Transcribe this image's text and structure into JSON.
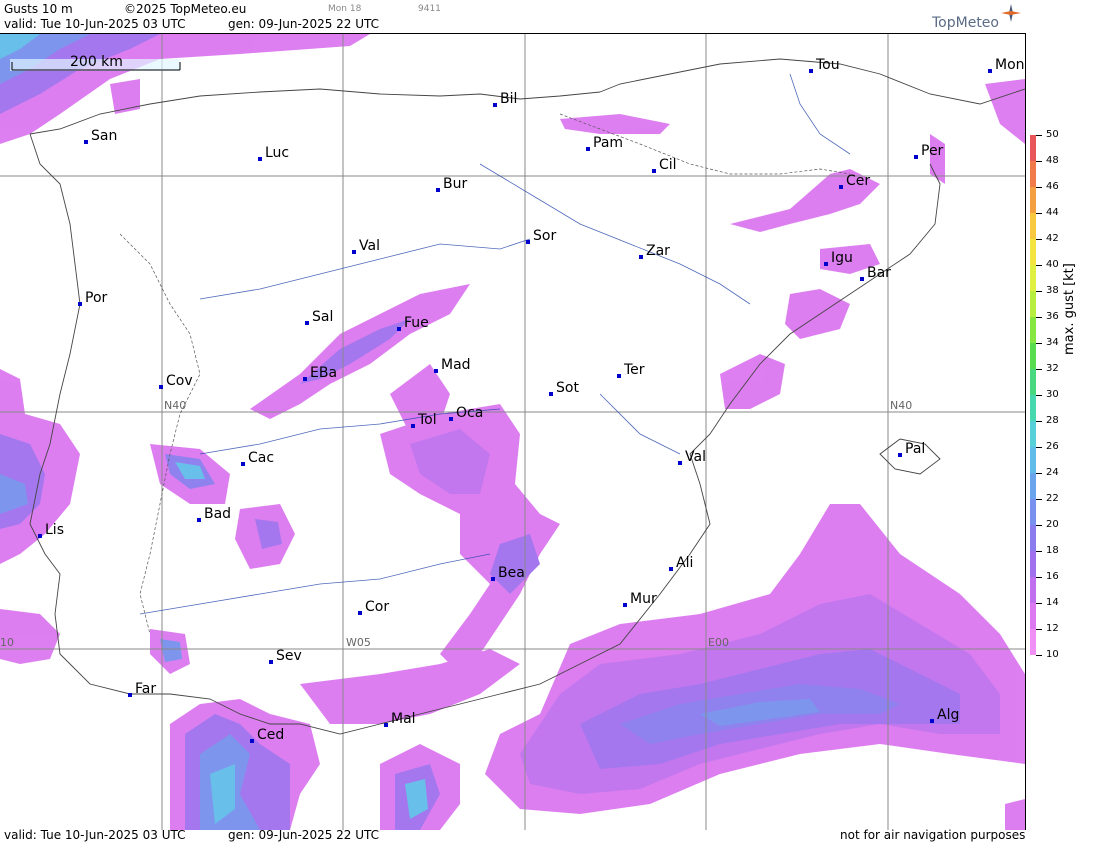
{
  "header": {
    "field": "Gusts 10 m",
    "copyright": "©2025 TopMeteo.eu",
    "run_day": "Mon 18",
    "run_code": "9411",
    "valid": "valid:  Tue  10-Jun-2025  03 UTC",
    "gen": "gen: 09-Jun-2025 22 UTC",
    "logo": "TopMeteo"
  },
  "footer": {
    "valid": "valid:  Tue  10-Jun-2025  03 UTC",
    "gen": "gen: 09-Jun-2025 22 UTC",
    "disclaimer": "not for air navigation purposes"
  },
  "scale_bar": "200 km",
  "grid_labels": {
    "n40_west": "N40",
    "n40_east": "N40",
    "w05": "W05",
    "e00": "E00",
    "w10": "10"
  },
  "legend": {
    "unit": "max. gust  [kt]",
    "levels": [
      "50",
      "48",
      "46",
      "44",
      "42",
      "40",
      "38",
      "36",
      "34",
      "32",
      "30",
      "28",
      "26",
      "24",
      "22",
      "20",
      "18",
      "16",
      "14",
      "12",
      "10"
    ],
    "colors": [
      "#e8565a",
      "#f07a4a",
      "#f4a040",
      "#f8c840",
      "#f4e440",
      "#e0f040",
      "#b8ee40",
      "#88e640",
      "#58dc50",
      "#48d880",
      "#48d8b0",
      "#58d0d8",
      "#60bce8",
      "#6aa4ec",
      "#7890ee",
      "#8a7cee",
      "#a070ee",
      "#c070ee",
      "#dc78f0",
      "#f090f4",
      "#ffffff"
    ]
  },
  "cities": [
    {
      "name": "Tou"
    },
    {
      "name": "Mon"
    },
    {
      "name": "Bil"
    },
    {
      "name": "San"
    },
    {
      "name": "Pam"
    },
    {
      "name": "Per"
    },
    {
      "name": "Luc"
    },
    {
      "name": "Cil"
    },
    {
      "name": "Cer"
    },
    {
      "name": "Bur"
    },
    {
      "name": "Sor"
    },
    {
      "name": "Val"
    },
    {
      "name": "Zar"
    },
    {
      "name": "Igu"
    },
    {
      "name": "Bar"
    },
    {
      "name": "Por"
    },
    {
      "name": "Sal"
    },
    {
      "name": "Fue"
    },
    {
      "name": "Mad"
    },
    {
      "name": "EBa"
    },
    {
      "name": "Cov"
    },
    {
      "name": "Ter"
    },
    {
      "name": "Sot"
    },
    {
      "name": "Tol"
    },
    {
      "name": "Oca"
    },
    {
      "name": "Pal"
    },
    {
      "name": "Cac"
    },
    {
      "name": "Val"
    },
    {
      "name": "Bad"
    },
    {
      "name": "Lis"
    },
    {
      "name": "Ali"
    },
    {
      "name": "Bea"
    },
    {
      "name": "Mur"
    },
    {
      "name": "Cor"
    },
    {
      "name": "Sev"
    },
    {
      "name": "Far"
    },
    {
      "name": "Alg"
    },
    {
      "name": "Mal"
    },
    {
      "name": "Ced"
    }
  ]
}
